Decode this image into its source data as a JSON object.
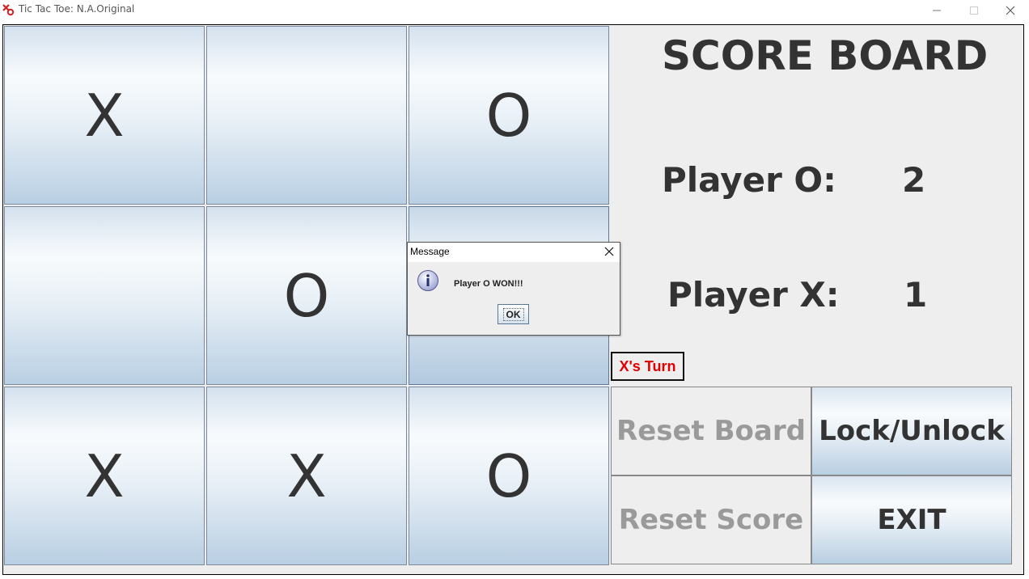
{
  "window": {
    "title": "Tic Tac Toe:  N.A.Original",
    "icon": "tic-tac-toe-app-icon"
  },
  "board": {
    "cells": [
      "X",
      "",
      "O",
      "",
      "O",
      "",
      "X",
      "X",
      "O"
    ]
  },
  "scoreboard": {
    "title": "SCORE BOARD",
    "player_o_label": "Player O:",
    "player_o_score": "2",
    "player_x_label": "Player X:",
    "player_x_score": "1"
  },
  "turn_indicator": "X's Turn",
  "controls": {
    "reset_board": "Reset Board",
    "lock_unlock": "Lock/Unlock",
    "reset_score": "Reset Score",
    "exit": "EXIT"
  },
  "dialog": {
    "title": "Message",
    "message": "Player O WON!!!",
    "ok_label": "OK",
    "icon": "info-icon"
  },
  "colors": {
    "turn_text": "#e00000",
    "disabled_text": "#9a9a9a"
  }
}
